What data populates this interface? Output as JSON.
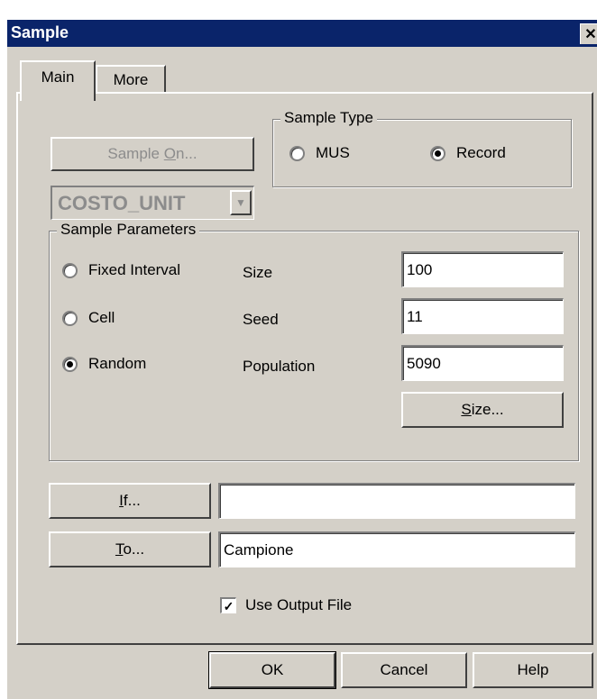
{
  "window": {
    "title": "Sample",
    "close_glyph": "✕"
  },
  "tabs": [
    {
      "label": "Main",
      "active": true
    },
    {
      "label": "More",
      "active": false
    }
  ],
  "sample_on": {
    "label_pre": "Sample ",
    "label_ul": "O",
    "label_post": "n...",
    "enabled": false
  },
  "field_combo": {
    "value": "COSTO_UNIT",
    "enabled": false
  },
  "sample_type": {
    "legend": "Sample Type",
    "options": [
      {
        "label": "MUS",
        "selected": false
      },
      {
        "label": "Record",
        "selected": true
      }
    ]
  },
  "sample_parameters": {
    "legend": "Sample Parameters",
    "methods": [
      {
        "label": "Fixed Interval",
        "selected": false
      },
      {
        "label": "Cell",
        "selected": false
      },
      {
        "label": "Random",
        "selected": true
      }
    ],
    "fields": [
      {
        "label": "Size",
        "value": "100"
      },
      {
        "label": "Seed",
        "value": "11"
      },
      {
        "label": "Population",
        "value": "5090"
      }
    ],
    "size_button": {
      "label_ul": "S",
      "label_post": "ize..."
    }
  },
  "if_row": {
    "button_ul": "I",
    "button_post": "f...",
    "value": ""
  },
  "to_row": {
    "button_ul": "T",
    "button_post": "o...",
    "value": "Campione"
  },
  "use_output_file": {
    "label": "Use Output File",
    "checked": true,
    "check_glyph": "✓"
  },
  "footer": {
    "ok_label": "OK",
    "cancel_label": "Cancel",
    "help_label": "Help"
  },
  "colors": {
    "titlebar": "#0a246a",
    "face": "#d4d0c8",
    "disabled_text": "#8c8c8c"
  }
}
